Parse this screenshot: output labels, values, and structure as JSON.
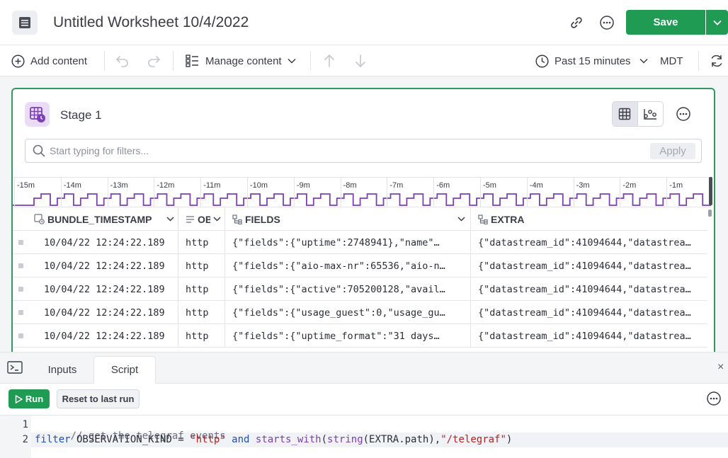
{
  "header": {
    "title": "Untitled Worksheet 10/4/2022",
    "save_label": "Save",
    "icons": [
      "app-icon",
      "link-icon",
      "more-icon",
      "chevron-down-icon"
    ]
  },
  "toolbar": {
    "add_content": "Add content",
    "manage_content": "Manage content",
    "time_range": "Past 15 minutes",
    "timezone": "MDT"
  },
  "stage": {
    "title": "Stage 1",
    "filter_placeholder": "Start typing for filters...",
    "apply_label": "Apply"
  },
  "timeline": {
    "ticks": [
      "-15m",
      "-14m",
      "-13m",
      "-12m",
      "-11m",
      "-10m",
      "-9m",
      "-8m",
      "-7m",
      "-6m",
      "-5m",
      "-4m",
      "-3m",
      "-2m",
      "-1m"
    ],
    "line_color": "#7b3fb6"
  },
  "table": {
    "columns": [
      "BUNDLE_TIMESTAMP",
      "OB",
      "FIELDS",
      "EXTRA"
    ],
    "rows": [
      [
        "10/04/22 12:24:22.189",
        "http",
        "{\"fields\":{\"uptime\":2748941},\"name\"…",
        "{\"datastream_id\":41094644,\"datastrea…"
      ],
      [
        "10/04/22 12:24:22.189",
        "http",
        "{\"fields\":{\"aio-max-nr\":65536,\"aio-n…",
        "{\"datastream_id\":41094644,\"datastrea…"
      ],
      [
        "10/04/22 12:24:22.189",
        "http",
        "{\"fields\":{\"active\":705200128,\"avail…",
        "{\"datastream_id\":41094644,\"datastrea…"
      ],
      [
        "10/04/22 12:24:22.189",
        "http",
        "{\"fields\":{\"usage_guest\":0,\"usage_gu…",
        "{\"datastream_id\":41094644,\"datastrea…"
      ],
      [
        "10/04/22 12:24:22.189",
        "http",
        "{\"fields\":{\"uptime_format\":\"31 days…",
        "{\"datastream_id\":41094644,\"datastrea…"
      ]
    ]
  },
  "bottom_panel": {
    "tabs": [
      "Inputs",
      "Script"
    ],
    "active_tab": "Script",
    "run_label": "Run",
    "reset_label": "Reset to last run",
    "close_glyph": "×",
    "line_numbers": [
      "1",
      "2"
    ],
    "code": {
      "line1": "// get the telegraf events",
      "line2_kw1": "filter",
      "line2_a": " OBSERVATION_KIND = ",
      "line2_str1": "\"http\"",
      "line2_kw2": " and ",
      "line2_fn1": "starts_with",
      "line2_b": "(",
      "line2_fn2": "string",
      "line2_c": "(EXTRA.path),",
      "line2_str2": "\"/telegraf\"",
      "line2_d": ")"
    }
  },
  "colors": {
    "accent_green": "#1f9b53",
    "stage_border": "#2f9a5d",
    "stage_icon_bg": "#eadcf6",
    "stage_icon_fg": "#7b3fb6"
  }
}
